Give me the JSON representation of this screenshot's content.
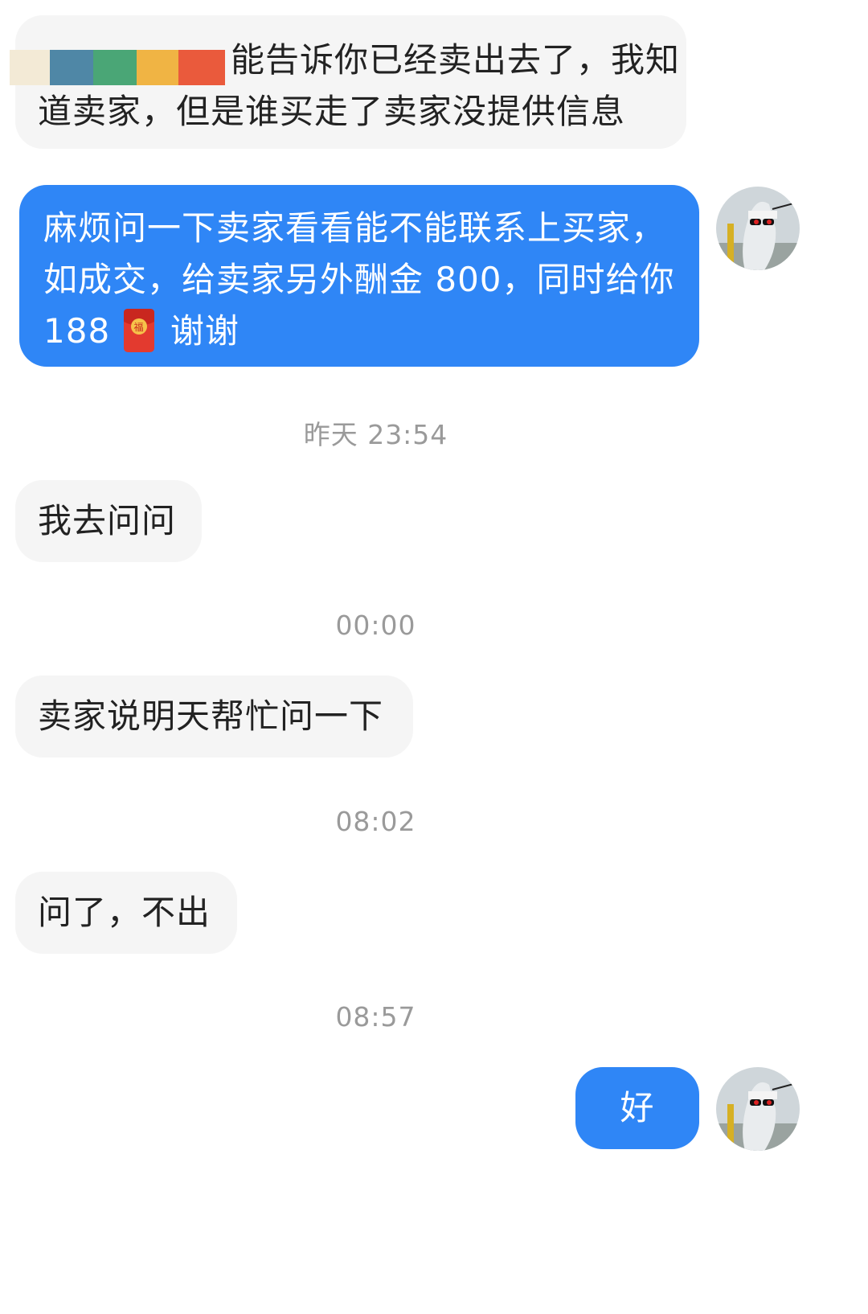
{
  "messages": [
    {
      "side": "incoming",
      "lines": [
        "能告诉你已经卖出去了，我知",
        "道卖家，但是谁买走了卖家没提供信息"
      ]
    },
    {
      "side": "outgoing",
      "lines": [
        "麻烦问一下卖家看看能不能联系上买家，",
        "如成交，给卖家另外酬金 800，同时给你",
        "188",
        "谢谢"
      ]
    },
    {
      "side": "incoming",
      "text": "我去问问"
    },
    {
      "side": "incoming",
      "text": "卖家说明天帮忙问一下"
    },
    {
      "side": "incoming",
      "text": "问了，不出"
    },
    {
      "side": "outgoing",
      "text": "好"
    }
  ],
  "timestamps": [
    "昨天 23:54",
    "00:00",
    "08:02",
    "08:57"
  ],
  "icons": {
    "avatar": "avatar-icon",
    "red_packet": "red-packet-icon"
  },
  "colors": {
    "outgoing_bubble": "#2f86f6",
    "incoming_bubble": "#f5f5f5",
    "timestamp_text": "#9a9a9a"
  }
}
